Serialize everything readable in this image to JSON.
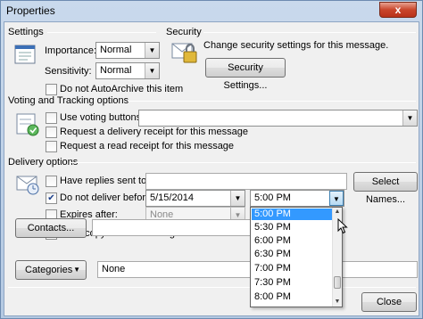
{
  "window": {
    "title": "Properties",
    "close_glyph": "x"
  },
  "settings": {
    "heading": "Settings",
    "importance_label": "Importance:",
    "importance_value": "Normal",
    "sensitivity_label": "Sensitivity:",
    "sensitivity_value": "Normal",
    "autoarchive_label": "Do not AutoArchive this item",
    "autoarchive_checked": false
  },
  "security": {
    "heading": "Security",
    "description": "Change security settings for this message.",
    "button_label": "Security Settings..."
  },
  "voting": {
    "heading": "Voting and Tracking options",
    "use_voting_label": "Use voting buttons:",
    "use_voting_value": "",
    "delivery_receipt_label": "Request a delivery receipt for this message",
    "read_receipt_label": "Request a read receipt for this message"
  },
  "delivery": {
    "heading": "Delivery options",
    "replies_label": "Have replies sent to:",
    "replies_value": "",
    "select_names_label": "Select Names...",
    "defer_label": "Do not deliver before:",
    "defer_checked": true,
    "defer_date": "5/15/2014",
    "defer_time": "5:00 PM",
    "expires_label": "Expires after:",
    "expires_checked": false,
    "expires_date": "None",
    "save_copy_label": "Save copy of sent message",
    "save_copy_checked": true
  },
  "contacts": {
    "button_label": "Contacts...",
    "value": ""
  },
  "categories": {
    "button_label": "Categories",
    "value": "None"
  },
  "footer": {
    "close_label": "Close"
  },
  "time_dropdown": {
    "items": [
      "5:00 PM",
      "5:30 PM",
      "6:00 PM",
      "6:30 PM",
      "7:00 PM",
      "7:30 PM",
      "8:00 PM"
    ],
    "selected_index": 0,
    "scroll_position": 0.85
  },
  "icons": {
    "settings": "properties-sheet-icon",
    "security": "lock-envelope-icon",
    "voting": "voting-checklist-icon",
    "delivery": "delivery-envelope-icon"
  },
  "colors": {
    "selection": "#3399ff",
    "title_gradient": "#c9d9ec",
    "close_red": "#c9452b"
  }
}
